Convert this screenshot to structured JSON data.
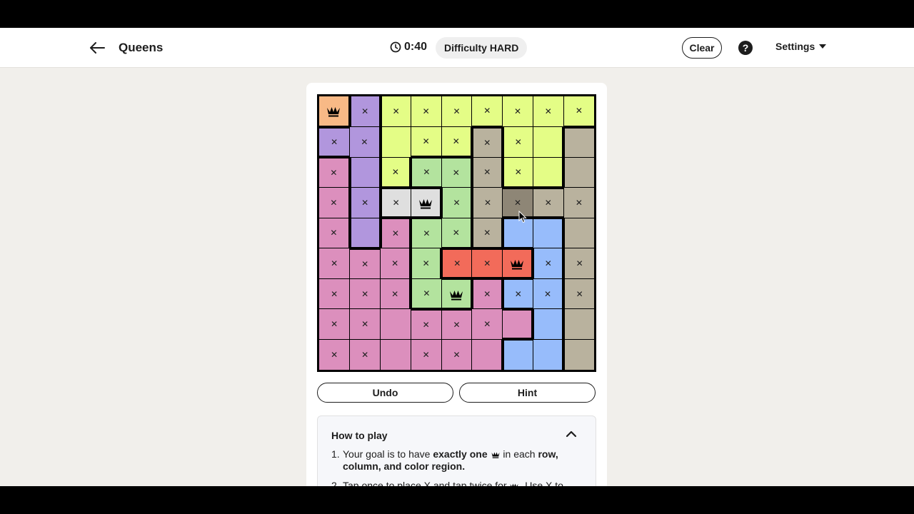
{
  "header": {
    "title": "Queens",
    "timer": "0:40",
    "difficulty_label": "Difficulty",
    "difficulty_value": "HARD",
    "clear_label": "Clear",
    "help_label": "?",
    "settings_label": "Settings"
  },
  "colors": {
    "orange": "#f8b986",
    "purple": "#b196dd",
    "yellow": "#e4fd86",
    "lightgreen": "#b3e39e",
    "tan": "#b9b29e",
    "gray": "#dfdfdf",
    "pink": "#dc8fbd",
    "blue": "#97bcfb",
    "red": "#f26b5a",
    "hovered": "#8e8676"
  },
  "board": {
    "size": 9,
    "regions": [
      [
        "orange",
        "purple",
        "yellow",
        "yellow",
        "yellow",
        "yellow",
        "yellow",
        "yellow",
        "yellow"
      ],
      [
        "purple",
        "purple",
        "yellow",
        "yellow",
        "yellow",
        "tan",
        "yellow",
        "yellow",
        "tan"
      ],
      [
        "pink",
        "purple",
        "yellow",
        "lightgreen",
        "lightgreen",
        "tan",
        "yellow",
        "yellow",
        "tan"
      ],
      [
        "pink",
        "purple",
        "gray",
        "gray",
        "lightgreen",
        "tan",
        "tan",
        "tan",
        "tan"
      ],
      [
        "pink",
        "purple",
        "pink",
        "lightgreen",
        "lightgreen",
        "tan",
        "blue",
        "blue",
        "tan"
      ],
      [
        "pink",
        "pink",
        "pink",
        "lightgreen",
        "red",
        "red",
        "red",
        "blue",
        "tan"
      ],
      [
        "pink",
        "pink",
        "pink",
        "lightgreen",
        "lightgreen",
        "pink",
        "blue",
        "blue",
        "tan"
      ],
      [
        "pink",
        "pink",
        "pink",
        "pink",
        "pink",
        "pink",
        "pink",
        "blue",
        "tan"
      ],
      [
        "pink",
        "pink",
        "pink",
        "pink",
        "pink",
        "pink",
        "blue",
        "blue",
        "tan"
      ]
    ],
    "marks": [
      "QXXXXXXXX",
      "XX.XXXX..",
      "X.XXXXX..",
      "XXXQXXXXX",
      "X.XXXX...",
      "XXXXXXQXX",
      "XXXXQXXXX",
      "XX.XXX...",
      "XX.XX...."
    ],
    "hovered_cell": [
      3,
      6
    ]
  },
  "controls": {
    "undo_label": "Undo",
    "hint_label": "Hint"
  },
  "howto": {
    "title": "How to play",
    "step1_num": "1.",
    "step1_a": "Your goal is to have ",
    "step1_b": "exactly one",
    "step1_c": " in each ",
    "step1_d": "row, column, and color region.",
    "step2_num": "2.",
    "step2_a": "Tap once to place X and tap twice for",
    "step2_b": ". Use X to"
  }
}
